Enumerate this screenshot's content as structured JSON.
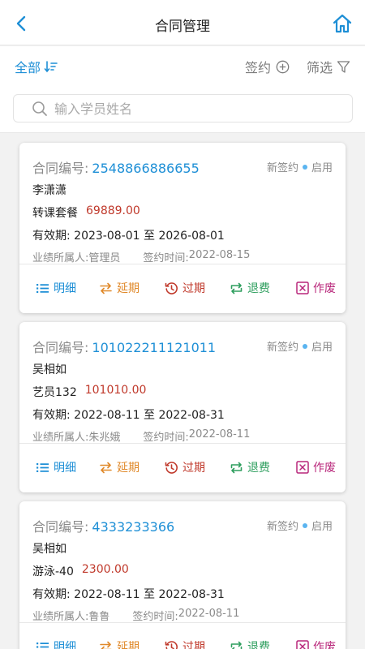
{
  "header": {
    "title": "合同管理"
  },
  "toolbar": {
    "all_label": "全部",
    "sign_label": "签约",
    "filter_label": "筛选"
  },
  "search": {
    "placeholder": "输入学员姓名"
  },
  "labels": {
    "contract_no": "合同编号:",
    "valid": "有效期:",
    "to": "至",
    "owner": "业绩所属人:",
    "sign_time": "签约时间:"
  },
  "actions": {
    "detail": "明细",
    "delay": "延期",
    "expire": "过期",
    "refund": "退费",
    "void": "作废"
  },
  "colors": {
    "accent": "#1e8fd6",
    "price": "#c0392b",
    "delay": "#e0892a",
    "refund": "#2e9e5e",
    "void": "#b8267a"
  },
  "contracts": [
    {
      "no": "2548866886655",
      "type": "新签约",
      "state": "启用",
      "student": "李潇潇",
      "package": "转课套餐",
      "price": "69889.00",
      "start": "2023-08-01",
      "end": "2026-08-01",
      "owner": "管理员",
      "sign_date": "2022-08-15"
    },
    {
      "no": "101022211121011",
      "type": "新签约",
      "state": "启用",
      "student": "吴相如",
      "package": "艺员132",
      "price": "101010.00",
      "start": "2022-08-11",
      "end": "2022-08-31",
      "owner": "朱兆娥",
      "sign_date": "2022-08-11"
    },
    {
      "no": "4333233366",
      "type": "新签约",
      "state": "启用",
      "student": "吴相如",
      "package": "游泳-40",
      "price": "2300.00",
      "start": "2022-08-11",
      "end": "2022-08-31",
      "owner": "鲁鲁",
      "sign_date": "2022-08-11"
    }
  ]
}
